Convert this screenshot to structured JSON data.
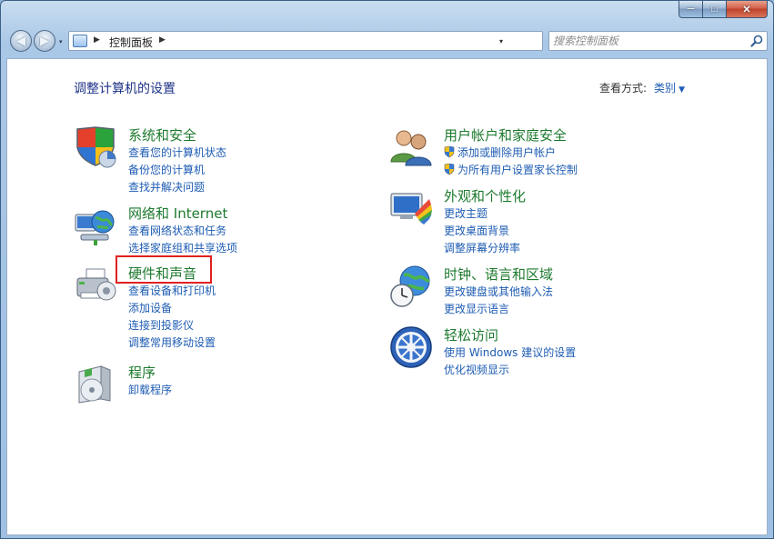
{
  "window": {
    "caption": {
      "minimize": "─",
      "maximize": "□",
      "close": "✕"
    }
  },
  "navbar": {
    "back": "◀",
    "forward": "▶",
    "history": "▾",
    "breadcrumb": "控制面板",
    "address_drop": "▾",
    "refresh": "↻",
    "search_placeholder": "搜索控制面板"
  },
  "content": {
    "heading": "调整计算机的设置",
    "view_by_label": "查看方式:",
    "view_by_value": "类别",
    "view_by_caret": "▼"
  },
  "categories": {
    "system": {
      "title": "系统和安全",
      "links": [
        "查看您的计算机状态",
        "备份您的计算机",
        "查找并解决问题"
      ]
    },
    "network": {
      "title": "网络和 Internet",
      "links": [
        "查看网络状态和任务",
        "选择家庭组和共享选项"
      ]
    },
    "hardware": {
      "title": "硬件和声音",
      "links": [
        "查看设备和打印机",
        "添加设备",
        "连接到投影仪",
        "调整常用移动设置"
      ]
    },
    "programs": {
      "title": "程序",
      "links": [
        "卸载程序"
      ]
    },
    "users": {
      "title": "用户帐户和家庭安全",
      "links": [
        "添加或删除用户帐户",
        "为所有用户设置家长控制"
      ]
    },
    "appearance": {
      "title": "外观和个性化",
      "links": [
        "更改主题",
        "更改桌面背景",
        "调整屏幕分辨率"
      ]
    },
    "clock": {
      "title": "时钟、语言和区域",
      "links": [
        "更改键盘或其他输入法",
        "更改显示语言"
      ]
    },
    "ease": {
      "title": "轻松访问",
      "links": [
        "使用 Windows 建议的设置",
        "优化视频显示"
      ]
    }
  },
  "colors": {
    "category_title": "#1d7a2e",
    "link": "#1e5cb3",
    "heading": "#1e3287",
    "highlight": "#e02020"
  }
}
